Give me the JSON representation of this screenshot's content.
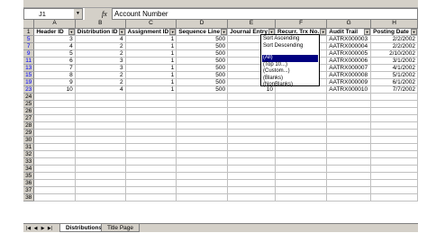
{
  "formula_bar": {
    "cell_ref": "J1",
    "fx": "fx",
    "value": "Account Number"
  },
  "grid": {
    "columns": [
      "A",
      "B",
      "C",
      "D",
      "E",
      "F",
      "G",
      "H"
    ],
    "headers": [
      "Header ID",
      "Distribution ID",
      "Assignment ID",
      "Sequence Line",
      "Journal Entry",
      "Recurr. Trx No.",
      "Audit Trail",
      "Posting Date"
    ],
    "rows": [
      {
        "num": "1"
      },
      {
        "num": "5",
        "cells": [
          "3",
          "4",
          "1",
          "500",
          "",
          "",
          "AATRX000003",
          "2/2/2002"
        ]
      },
      {
        "num": "7",
        "cells": [
          "4",
          "2",
          "1",
          "500",
          "",
          "",
          "AATRX000004",
          "2/2/2002"
        ]
      },
      {
        "num": "9",
        "cells": [
          "5",
          "2",
          "1",
          "500",
          "",
          "",
          "AATRX000005",
          "2/10/2002"
        ]
      },
      {
        "num": "11",
        "cells": [
          "6",
          "3",
          "1",
          "500",
          "",
          "",
          "AATRX000006",
          "3/1/2002"
        ]
      },
      {
        "num": "13",
        "cells": [
          "7",
          "3",
          "1",
          "500",
          "",
          "",
          "AATRX000007",
          "4/1/2002"
        ]
      },
      {
        "num": "15",
        "cells": [
          "8",
          "2",
          "1",
          "500",
          "",
          "",
          "AATRX000008",
          "5/1/2002"
        ]
      },
      {
        "num": "19",
        "cells": [
          "9",
          "2",
          "1",
          "500",
          "9",
          "",
          "AATRX000009",
          "6/1/2002"
        ]
      },
      {
        "num": "23",
        "cells": [
          "10",
          "4",
          "1",
          "500",
          "10",
          "",
          "AATRX000010",
          "7/7/2002"
        ]
      },
      {
        "num": "24"
      },
      {
        "num": "25"
      },
      {
        "num": "26"
      },
      {
        "num": "27"
      },
      {
        "num": "28"
      },
      {
        "num": "29"
      },
      {
        "num": "30"
      },
      {
        "num": "31"
      },
      {
        "num": "32"
      },
      {
        "num": "33"
      },
      {
        "num": "34"
      },
      {
        "num": "35"
      },
      {
        "num": "36"
      },
      {
        "num": "37"
      },
      {
        "num": "38"
      }
    ]
  },
  "filter_menu": {
    "items": [
      "Sort Ascending",
      "Sort Descending",
      "(All)",
      "(Top 10...)",
      "(Custom...)",
      "(Blanks)",
      "(NonBlanks)"
    ],
    "selected": "(All)"
  },
  "tabs": {
    "active": "Distributions",
    "other": "Title Page"
  },
  "colors": {
    "chrome": "#d4d0c8",
    "filtered_row_header": "#0000ff",
    "menu_highlight": "#000080"
  }
}
